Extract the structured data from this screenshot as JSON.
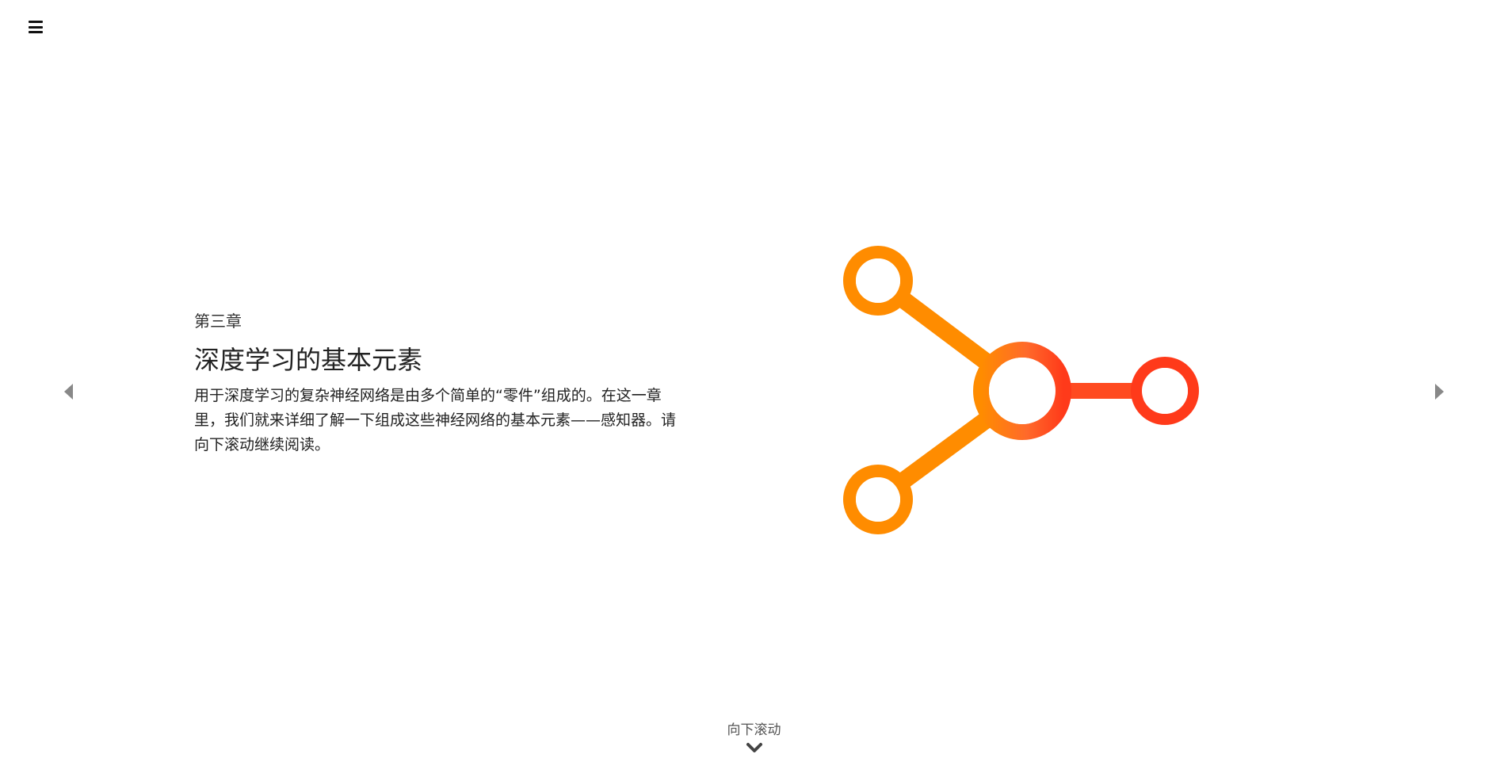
{
  "header": {
    "menu_icon": "hamburger-menu-icon"
  },
  "navigation": {
    "prev_icon": "caret-left-icon",
    "next_icon": "caret-right-icon"
  },
  "chapter": {
    "label": "第三章",
    "title": "深度学习的基本元素",
    "description": "用于深度学习的复杂神经网络是由多个简单的“零件”组成的。在这一章里，我们就来详细了解一下组成这些神经网络的基本元素——感知器。请向下滚动继续阅读。"
  },
  "graphic": {
    "icon": "perceptron-network-icon",
    "colors": {
      "orange": "#FF8C00",
      "red_orange": "#FF5A2E",
      "red": "#FF3A1A"
    }
  },
  "scroll_hint": {
    "label": "向下滚动",
    "icon": "chevron-down-icon"
  }
}
